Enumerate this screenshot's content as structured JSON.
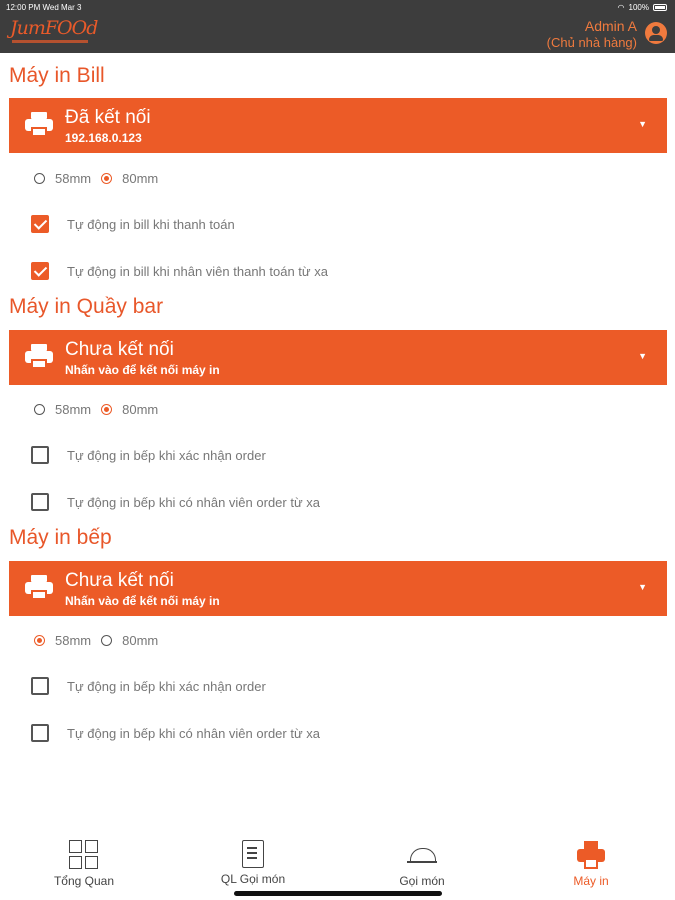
{
  "status_bar": {
    "time": "12:00 PM  Wed Mar 3",
    "battery": "100%"
  },
  "header": {
    "logo_text": "JumFOOd",
    "user_name": "Admin A",
    "user_role": "(Chủ nhà hàng)"
  },
  "sections": [
    {
      "title": "Máy in Bill",
      "status": "Đã kết nối",
      "detail": "192.168.0.123",
      "paper_options": [
        "58mm",
        "80mm"
      ],
      "paper_selected": "80mm",
      "options": [
        {
          "label": "Tự động in bill khi thanh toán",
          "checked": true
        },
        {
          "label": "Tự động in bill khi nhân viên thanh toán từ xa",
          "checked": true
        }
      ]
    },
    {
      "title": "Máy in Quầy bar",
      "status": "Chưa kết nối",
      "detail": "Nhấn vào để kết nối máy in",
      "paper_options": [
        "58mm",
        "80mm"
      ],
      "paper_selected": "80mm",
      "options": [
        {
          "label": "Tự động in bếp khi xác nhận order",
          "checked": false
        },
        {
          "label": "Tự động in bếp khi có nhân viên order từ xa",
          "checked": false
        }
      ]
    },
    {
      "title": "Máy in bếp",
      "status": "Chưa kết nối",
      "detail": "Nhấn vào để kết nối máy in",
      "paper_options": [
        "58mm",
        "80mm"
      ],
      "paper_selected": "58mm",
      "options": [
        {
          "label": "Tự động in bếp khi xác nhận order",
          "checked": false
        },
        {
          "label": "Tự động in bếp khi có nhân viên order từ xa",
          "checked": false
        }
      ]
    }
  ],
  "bottom_nav": [
    {
      "label": "Tổng Quan",
      "icon": "grid-icon",
      "active": false
    },
    {
      "label": "QL Gọi món",
      "icon": "order-list-icon",
      "active": false
    },
    {
      "label": "Gọi món",
      "icon": "cloche-icon",
      "active": false
    },
    {
      "label": "Máy in",
      "icon": "printer-icon",
      "active": true
    }
  ],
  "colors": {
    "accent": "#ec5b27",
    "header_bg": "#3d3d3d"
  }
}
